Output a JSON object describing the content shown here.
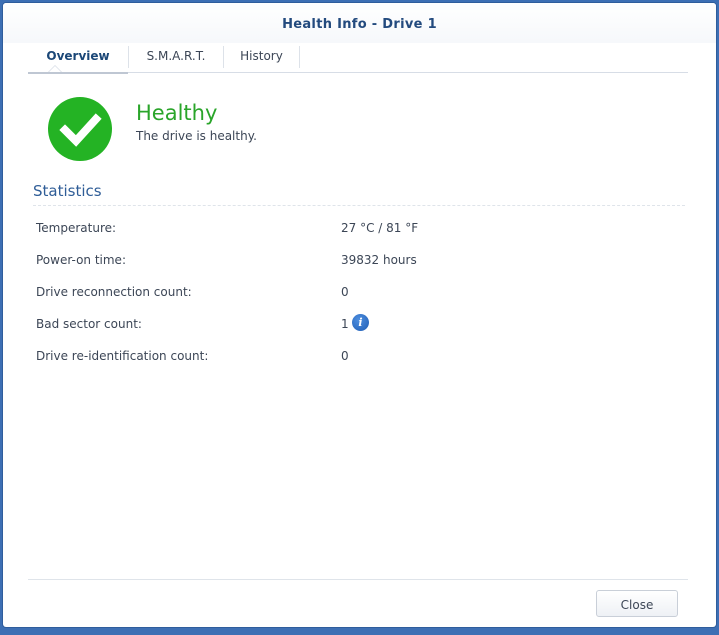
{
  "window": {
    "title": "Health Info - Drive 1"
  },
  "tabs": [
    {
      "label": "Overview",
      "active": true
    },
    {
      "label": "S.M.A.R.T.",
      "active": false
    },
    {
      "label": "History",
      "active": false
    }
  ],
  "status": {
    "icon": "check-circle-icon",
    "title": "Healthy",
    "description": "The drive is healthy.",
    "color": "#24b324"
  },
  "statistics": {
    "title": "Statistics",
    "rows": [
      {
        "label": "Temperature:",
        "value": "27 °C / 81 °F"
      },
      {
        "label": "Power-on time:",
        "value": "39832 hours"
      },
      {
        "label": "Drive reconnection count:",
        "value": "0"
      },
      {
        "label": "Bad sector count:",
        "value": "1",
        "info_icon": "i"
      },
      {
        "label": "Drive re-identification count:",
        "value": "0"
      }
    ]
  },
  "footer": {
    "close_label": "Close"
  },
  "colors": {
    "accent": "#1b4777",
    "healthy": "#2aa52a",
    "info": "#1f5db4",
    "frame": "#3d6fb4"
  }
}
